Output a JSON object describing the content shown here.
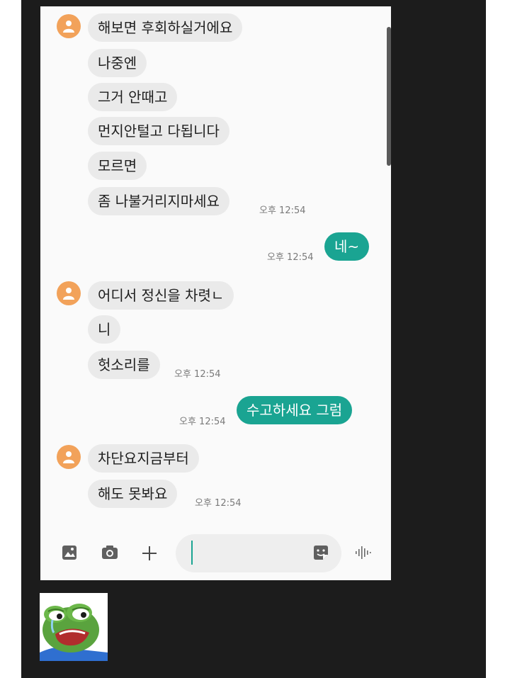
{
  "messages": [
    {
      "sender": "other",
      "text": "해보면 후회하실거에요"
    },
    {
      "sender": "other",
      "text": "나중엔"
    },
    {
      "sender": "other",
      "text": "그거 안때고"
    },
    {
      "sender": "other",
      "text": "먼지안털고 다됩니다"
    },
    {
      "sender": "other",
      "text": "모르면"
    },
    {
      "sender": "other",
      "text": "좀 나불거리지마세요",
      "time": "오후 12:54"
    },
    {
      "sender": "me",
      "text": "네~",
      "time": "오후 12:54"
    },
    {
      "sender": "other",
      "text": "어디서 정신을 차렷ㄴ"
    },
    {
      "sender": "other",
      "text": "니"
    },
    {
      "sender": "other",
      "text": "헛소리를",
      "time": "오후 12:54"
    },
    {
      "sender": "me",
      "text": "수고하세요 그럼",
      "time": "오후 12:54"
    },
    {
      "sender": "other",
      "text": "차단요지금부터"
    },
    {
      "sender": "other",
      "text": "해도 못봐요",
      "time": "오후 12:54"
    }
  ],
  "input": {
    "value": "",
    "icons": [
      "gallery-icon",
      "camera-icon",
      "plus-icon",
      "sticker-icon",
      "voice-icon"
    ]
  },
  "colors": {
    "accent": "#1aa492",
    "avatar": "#f2a25a",
    "incoming_bubble": "#eaeaea"
  }
}
